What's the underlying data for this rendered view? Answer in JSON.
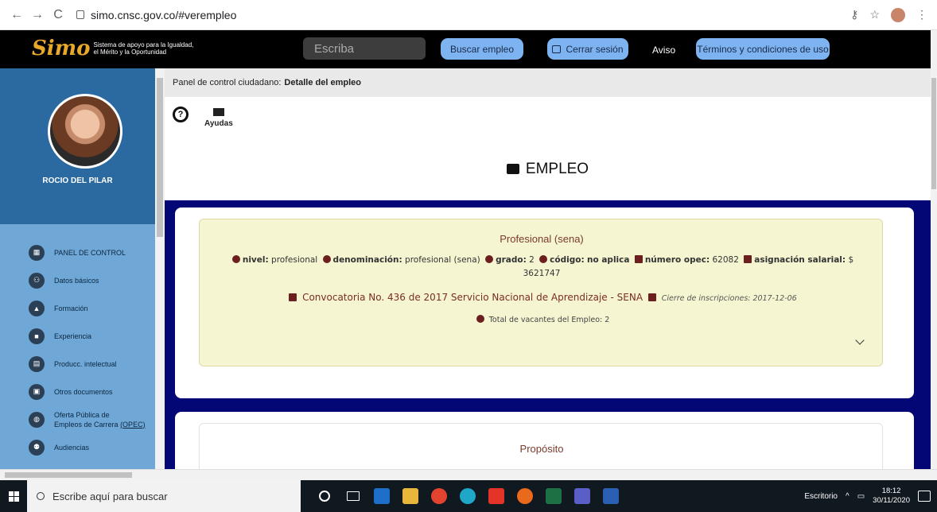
{
  "browser": {
    "url": "simo.cnsc.gov.co/#verempleo"
  },
  "header": {
    "logo_mark": "Simo",
    "logo_tagline": "Sistema de apoyo para la Igualdad, el Mérito y la Oportunidad",
    "search_placeholder": "Escriba",
    "buscar_label": "Buscar empleo",
    "cerrar_label": "Cerrar sesión",
    "aviso_label": "Aviso",
    "terminos_label": "Términos y condiciones de uso"
  },
  "sidebar": {
    "profile_name": "ROCIO DEL PILAR",
    "items": [
      {
        "label": "PANEL DE CONTROL",
        "icon": "dashboard-icon"
      },
      {
        "label": "Datos básicos",
        "icon": "users-icon"
      },
      {
        "label": "Formación",
        "icon": "graduation-icon"
      },
      {
        "label": "Experiencia",
        "icon": "briefcase-icon"
      },
      {
        "label": "Producc. intelectual",
        "icon": "document-icon"
      },
      {
        "label": "Otros documentos",
        "icon": "file-icon"
      },
      {
        "label": "Oferta Pública de",
        "label_line2": "Empleos de Carrera",
        "label_link": "(OPEC)",
        "icon": "globe-icon"
      },
      {
        "label": "Audiencias",
        "icon": "audience-icon"
      }
    ]
  },
  "main": {
    "breadcrumb_prefix": "Panel de control ciudadano:",
    "breadcrumb_page": "Detalle del empleo",
    "ayudas_label": "Ayudas",
    "title": "EMPLEO",
    "job": {
      "name": "Profesional (sena)",
      "nivel_label": "nivel:",
      "nivel": "profesional",
      "denominacion_label": "denominación:",
      "denominacion": "profesional (sena)",
      "grado_label": "grado:",
      "grado": "2",
      "codigo_label": "código:",
      "codigo": "no aplica",
      "opec_label": "número opec:",
      "opec": "62082",
      "asignacion_label": "asignación salarial:",
      "asignacion": "$ 3621747",
      "convocatoria": "Convocatoria No. 436 de 2017 Servicio Nacional de Aprendizaje - SENA",
      "cierre": "Cierre de inscripciones: 2017-12-06",
      "vacantes": "Total de vacantes del Empleo: 2"
    },
    "proposito_title": "Propósito"
  },
  "taskbar": {
    "search_placeholder": "Escribe aquí para buscar",
    "desktop_label": "Escritorio",
    "time": "18:12",
    "date": "30/11/2020"
  },
  "colors": {
    "navy": "#020775",
    "header_button": "#7db3f0",
    "sidebar": "#6fa8d6",
    "card_bg": "#f6f5d2"
  }
}
